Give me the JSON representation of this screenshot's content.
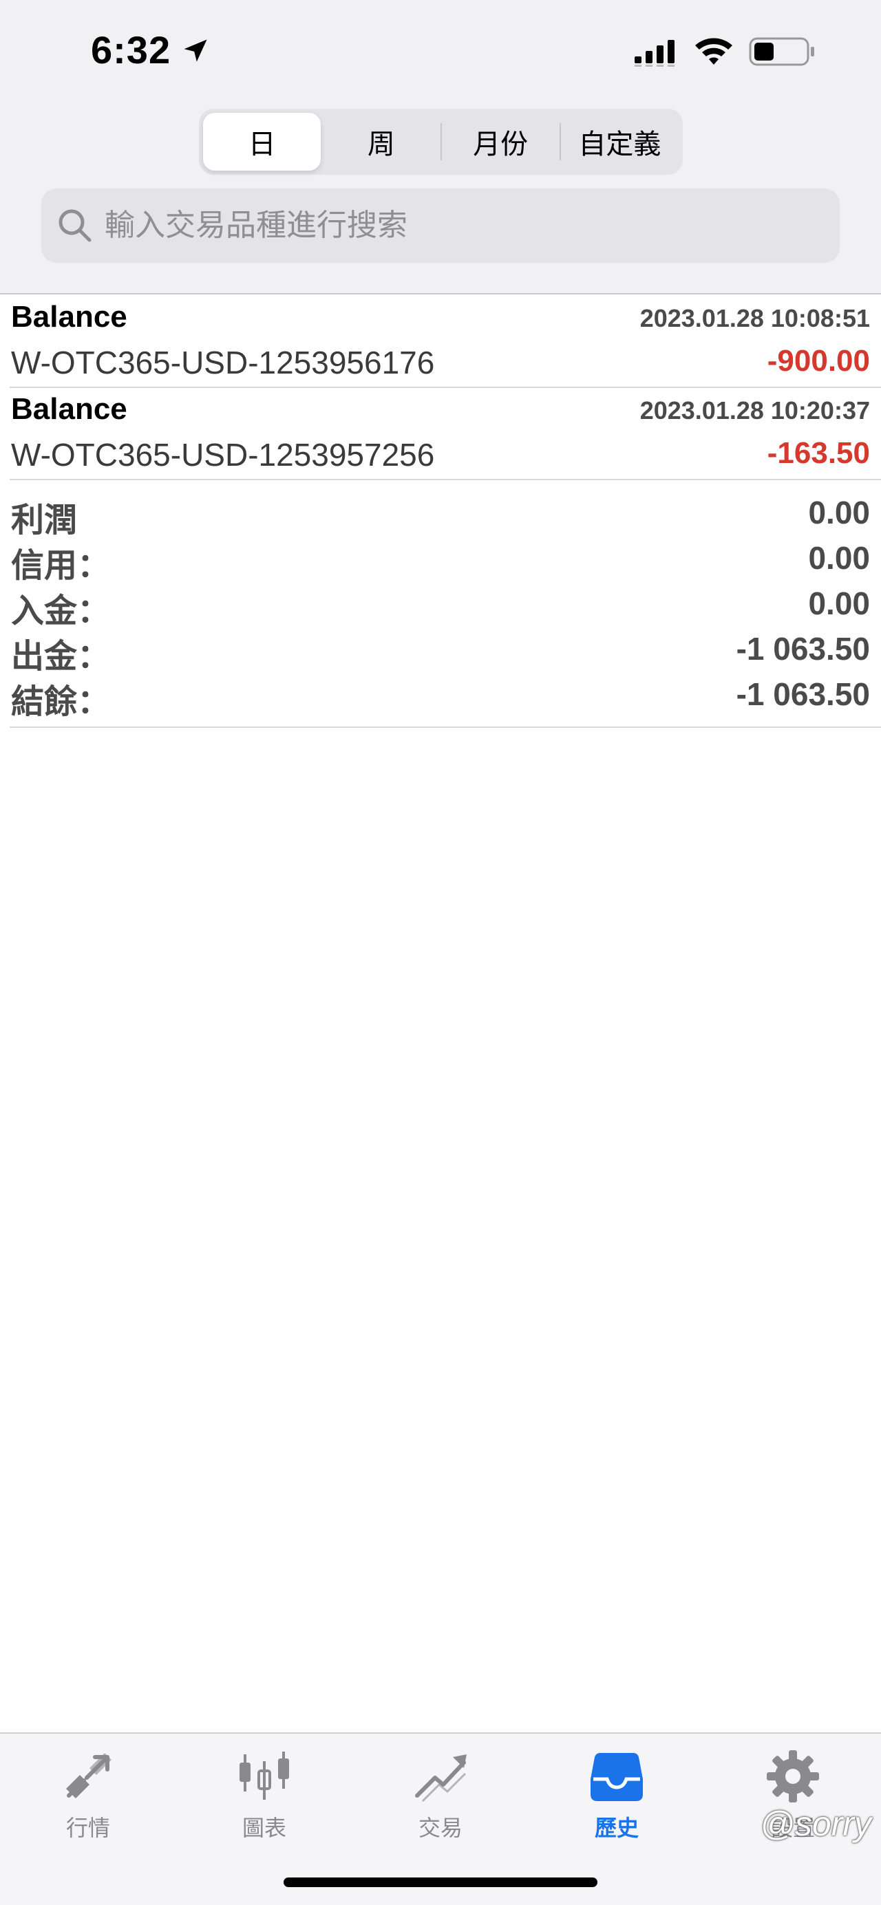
{
  "status_bar": {
    "time": "6:32"
  },
  "period_tabs": [
    {
      "label": "日",
      "active": true
    },
    {
      "label": "周",
      "active": false
    },
    {
      "label": "月份",
      "active": false
    },
    {
      "label": "自定義",
      "active": false
    }
  ],
  "search": {
    "placeholder": "輸入交易品種進行搜索",
    "value": ""
  },
  "records": [
    {
      "type": "Balance",
      "datetime": "2023.01.28 10:08:51",
      "account": "W-OTC365-USD-1253956176",
      "amount": "-900.00"
    },
    {
      "type": "Balance",
      "datetime": "2023.01.28 10:20:37",
      "account": "W-OTC365-USD-1253957256",
      "amount": "-163.50"
    }
  ],
  "summary": [
    {
      "label": "利潤",
      "value": "0.00"
    },
    {
      "label": "信用：",
      "value": "0.00"
    },
    {
      "label": "入金：",
      "value": "0.00"
    },
    {
      "label": "出金：",
      "value": "-1 063.50"
    },
    {
      "label": "結餘：",
      "value": "-1 063.50"
    }
  ],
  "tab_bar": [
    {
      "label": "行情",
      "icon": "quotes-arrows-icon",
      "active": false
    },
    {
      "label": "圖表",
      "icon": "candlestick-chart-icon",
      "active": false
    },
    {
      "label": "交易",
      "icon": "trade-trend-icon",
      "active": false
    },
    {
      "label": "歷史",
      "icon": "history-inbox-icon",
      "active": true
    },
    {
      "label": "設置",
      "icon": "gear-icon",
      "active": false
    }
  ],
  "watermark": "@sorry",
  "colors": {
    "negative": "#d5382c",
    "accent": "#1a73e8",
    "inactive_icon": "#8a8a8e"
  }
}
